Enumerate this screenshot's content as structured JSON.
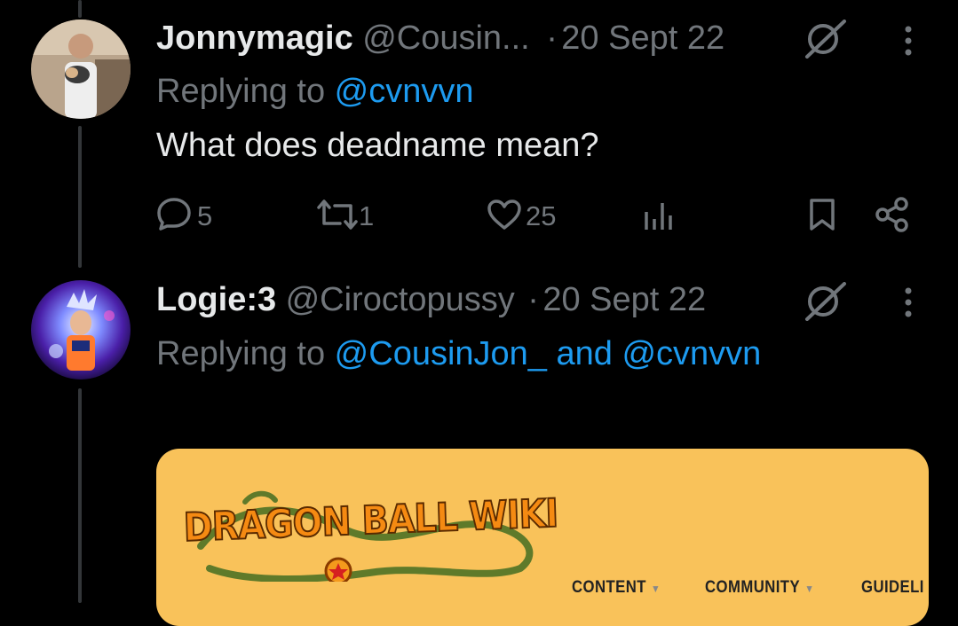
{
  "tweets": [
    {
      "name": "Jonnymagic",
      "handle": "@Cousin...",
      "separator": "·",
      "date": "20 Sept 22",
      "replying_prefix": "Replying to ",
      "replying_to": "@cvnvvn",
      "text": "What does deadname mean?",
      "replies": "5",
      "retweets": "1",
      "likes": "25"
    },
    {
      "name": "Logie:3",
      "handle": "@Ciroctopussy",
      "separator": "·",
      "date": "20 Sept 22",
      "replying_prefix": "Replying to ",
      "replying_to_1": "@CousinJon_",
      "replying_and": " and ",
      "replying_to_2": "@cvnvvn"
    }
  ],
  "card": {
    "logo_text": "DRAGON BALL WIKI",
    "nav": [
      "CONTENT",
      "COMMUNITY",
      "GUIDELI"
    ],
    "background": "#f9c25a"
  },
  "icons": [
    "reply-icon",
    "retweet-icon",
    "like-icon",
    "views-icon",
    "bookmark-icon",
    "share-icon",
    "more-icon",
    "grok-icon"
  ],
  "colors": {
    "background": "#000000",
    "text": "#e7e9ea",
    "muted": "#71767b",
    "link": "#1d9bf0"
  }
}
